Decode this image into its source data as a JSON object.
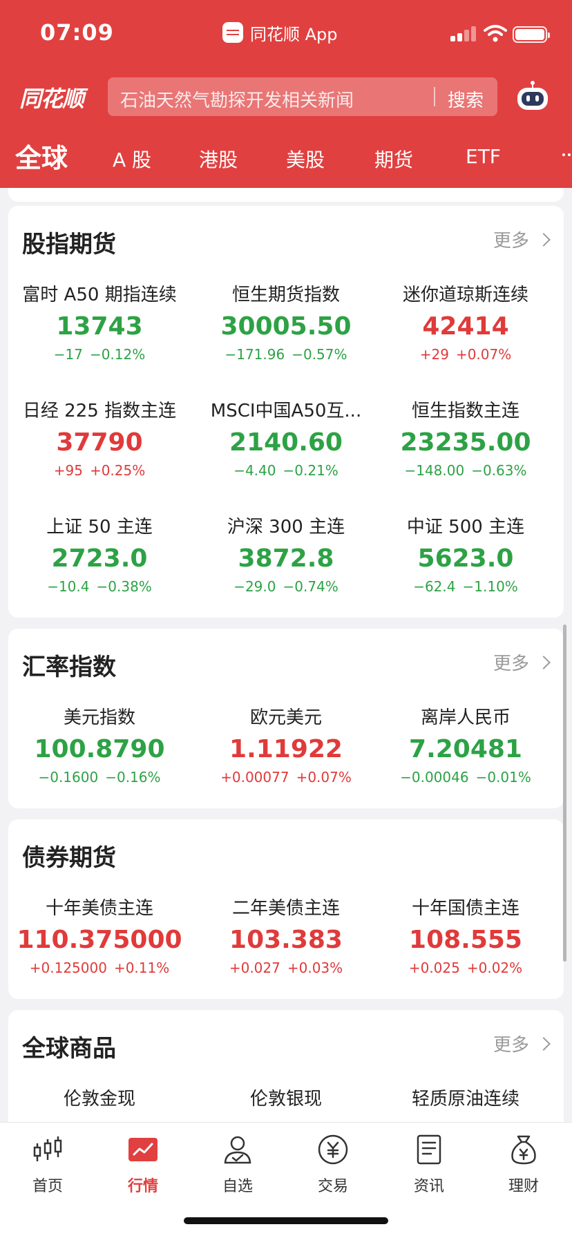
{
  "status_bar": {
    "time": "07:09",
    "app_name": "同花顺 App"
  },
  "header": {
    "logo": "同花顺",
    "search": {
      "placeholder": "石油天然气勘探开发相关新闻",
      "button": "搜索"
    },
    "robot_icon": "robot-assistant-icon",
    "tabs": [
      {
        "label": "全球",
        "active": true
      },
      {
        "label": "A 股",
        "active": false
      },
      {
        "label": "港股",
        "active": false
      },
      {
        "label": "美股",
        "active": false
      },
      {
        "label": "期货",
        "active": false
      },
      {
        "label": "ETF",
        "active": false
      }
    ]
  },
  "colors": {
    "brand": "#e14040",
    "up": "#e03a3a",
    "down": "#2da245"
  },
  "sections": [
    {
      "title": "股指期货",
      "more": "更多",
      "items": [
        {
          "name": "富时 A50 期指连续",
          "value": "13743",
          "change": "−17",
          "pct": "−0.12%",
          "dir": "down"
        },
        {
          "name": "恒生期货指数",
          "value": "30005.50",
          "change": "−171.96",
          "pct": "−0.57%",
          "dir": "down"
        },
        {
          "name": "迷你道琼斯连续",
          "value": "42414",
          "change": "+29",
          "pct": "+0.07%",
          "dir": "up"
        },
        {
          "name": "日经 225 指数主连",
          "value": "37790",
          "change": "+95",
          "pct": "+0.25%",
          "dir": "up"
        },
        {
          "name": "MSCI中国A50互...",
          "value": "2140.60",
          "change": "−4.40",
          "pct": "−0.21%",
          "dir": "down"
        },
        {
          "name": "恒生指数主连",
          "value": "23235.00",
          "change": "−148.00",
          "pct": "−0.63%",
          "dir": "down"
        },
        {
          "name": "上证 50 主连",
          "value": "2723.0",
          "change": "−10.4",
          "pct": "−0.38%",
          "dir": "down"
        },
        {
          "name": "沪深 300 主连",
          "value": "3872.8",
          "change": "−29.0",
          "pct": "−0.74%",
          "dir": "down"
        },
        {
          "name": "中证 500 主连",
          "value": "5623.0",
          "change": "−62.4",
          "pct": "−1.10%",
          "dir": "down"
        }
      ]
    },
    {
      "title": "汇率指数",
      "more": "更多",
      "items": [
        {
          "name": "美元指数",
          "value": "100.8790",
          "change": "−0.1600",
          "pct": "−0.16%",
          "dir": "down"
        },
        {
          "name": "欧元美元",
          "value": "1.11922",
          "change": "+0.00077",
          "pct": "+0.07%",
          "dir": "up"
        },
        {
          "name": "离岸人民币",
          "value": "7.20481",
          "change": "−0.00046",
          "pct": "−0.01%",
          "dir": "down"
        }
      ]
    },
    {
      "title": "债券期货",
      "more": "",
      "items": [
        {
          "name": "十年美债主连",
          "value": "110.375000",
          "change": "+0.125000",
          "pct": "+0.11%",
          "dir": "up"
        },
        {
          "name": "二年美债主连",
          "value": "103.383",
          "change": "+0.027",
          "pct": "+0.03%",
          "dir": "up"
        },
        {
          "name": "十年国债主连",
          "value": "108.555",
          "change": "+0.025",
          "pct": "+0.02%",
          "dir": "up"
        }
      ]
    },
    {
      "title": "全球商品",
      "more": "更多",
      "items": [
        {
          "name": "伦敦金现",
          "value": "",
          "change": "",
          "pct": "",
          "dir": "up"
        },
        {
          "name": "伦敦银现",
          "value": "",
          "change": "",
          "pct": "",
          "dir": "up"
        },
        {
          "name": "轻质原油连续",
          "value": "",
          "change": "",
          "pct": "",
          "dir": "up"
        }
      ]
    }
  ],
  "bottom_nav": [
    {
      "label": "首页",
      "icon": "candlestick-icon",
      "active": false
    },
    {
      "label": "行情",
      "icon": "market-chart-icon",
      "active": true
    },
    {
      "label": "自选",
      "icon": "person-check-icon",
      "active": false
    },
    {
      "label": "交易",
      "icon": "yuan-coin-icon",
      "active": false
    },
    {
      "label": "资讯",
      "icon": "news-document-icon",
      "active": false
    },
    {
      "label": "理财",
      "icon": "money-bag-icon",
      "active": false
    }
  ]
}
